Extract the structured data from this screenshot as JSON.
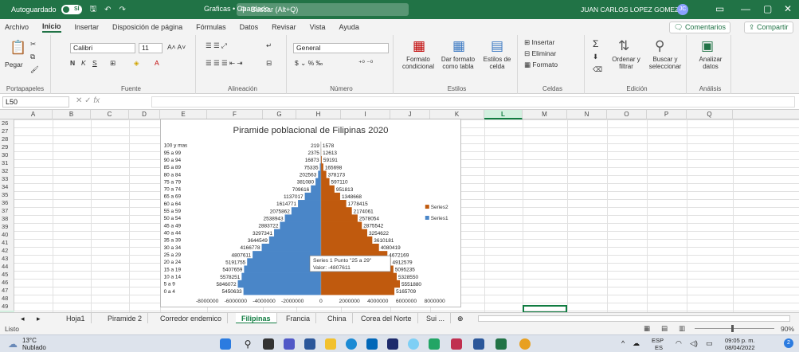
{
  "titlebar": {
    "autosave": "Autoguardado",
    "autosave_state": "SÍ",
    "doc_title": "Graficas • Guardado",
    "search": "Buscar (Alt+Q)",
    "user": "JUAN CARLOS LOPEZ GOMEZ",
    "initials": "JC"
  },
  "menu": [
    "Archivo",
    "Inicio",
    "Insertar",
    "Disposición de página",
    "Fórmulas",
    "Datos",
    "Revisar",
    "Vista",
    "Ayuda"
  ],
  "comments_label": "Comentarios",
  "share_label": "Compartir",
  "ribbon": {
    "clipboard": {
      "paste": "Pegar",
      "label": "Portapapeles"
    },
    "font": {
      "name": "Calibri",
      "size": "11",
      "label": "Fuente"
    },
    "alignment": {
      "label": "Alineación"
    },
    "number": {
      "format": "General",
      "label": "Número"
    },
    "styles": {
      "cond": "Formato condicional",
      "table": "Dar formato como tabla",
      "cell": "Estilos de celda",
      "label": "Estilos"
    },
    "cells": {
      "insert": "Insertar",
      "delete": "Eliminar",
      "format": "Formato",
      "label": "Celdas"
    },
    "editing": {
      "sort": "Ordenar y filtrar",
      "find": "Buscar y seleccionar",
      "label": "Edición"
    },
    "analysis": {
      "analyze": "Analizar datos",
      "label": "Análisis"
    }
  },
  "namebox": "L50",
  "fx": "fx",
  "columns": [
    "A",
    "B",
    "C",
    "D",
    "E",
    "F",
    "G",
    "H",
    "I",
    "J",
    "K",
    "L",
    "M",
    "N",
    "O",
    "P",
    "Q"
  ],
  "rows": [
    "26",
    "27",
    "28",
    "29",
    "30",
    "31",
    "32",
    "33",
    "34",
    "35",
    "36",
    "37",
    "38",
    "39",
    "40",
    "41",
    "42",
    "43",
    "44",
    "45",
    "46",
    "47",
    "48",
    "49",
    "50"
  ],
  "sheets": [
    "Hoja1",
    "Piramide 2",
    "Corredor endemico",
    "Filipinas",
    "Francia",
    "China",
    "Corea del Norte",
    "Sui ..."
  ],
  "active_sheet": "Filipinas",
  "status": {
    "ready": "Listo",
    "zoom": "90%"
  },
  "taskbar": {
    "temp": "13°C",
    "weather": "Nublado",
    "lang": "ESP",
    "region": "ES",
    "time": "09:05 p. m.",
    "date": "08/04/2022"
  },
  "colors": {
    "excel_green": "#217346",
    "series1": "#4a86c8",
    "series2": "#c05a0e"
  },
  "chart_data": {
    "type": "bar",
    "orientation": "horizontal",
    "title": "Piramide poblacional de Filipinas 2020",
    "categories": [
      "0 a 4",
      "5 a 9",
      "10 a 14",
      "15 a 19",
      "20 a 24",
      "25 a 29",
      "30 a 34",
      "35 a 39",
      "40 a 44",
      "45 a 49",
      "50 a 54",
      "55 a 59",
      "60 a 64",
      "65 a 69",
      "70 a 74",
      "75 a 79",
      "80 a 84",
      "85 a 89",
      "90 a 94",
      "95 a 99",
      "100 y mas"
    ],
    "series": [
      {
        "name": "Series1",
        "color": "#4a86c8",
        "values": [
          -5450633,
          -5846072,
          -5578251,
          -5407659,
          -5191755,
          -4807611,
          -4166778,
          -3644549,
          -3297341,
          -2883722,
          -2538943,
          -2075862,
          -1614771,
          -1137017,
          -709616,
          -381080,
          -202563,
          -75335,
          -16873,
          -2375,
          -219
        ]
      },
      {
        "name": "Series2",
        "color": "#c05a0e",
        "values": [
          5165709,
          5551880,
          5328550,
          5095235,
          4912579,
          4672169,
          4080419,
          3610181,
          3254622,
          2875542,
          2578054,
          2174061,
          1778415,
          1348668,
          951813,
          597110,
          378173,
          165698,
          59191,
          12613,
          1578
        ]
      }
    ],
    "labels_series1": [
      "5450633",
      "5846072",
      "5578251",
      "5407659",
      "5191755",
      "4807611",
      "4166778",
      "3644549",
      "3297341",
      "2883722",
      "2538943",
      "2075862",
      "1614771",
      "1137017",
      "709616",
      "381080",
      "202563",
      "75335",
      "16873",
      "2375",
      "219"
    ],
    "labels_series2": [
      "5165709",
      "5551880",
      "5328550",
      "5095235",
      "4912579",
      "4672169",
      "4080419",
      "3610181",
      "3254622",
      "2875542",
      "2578054",
      "2174061",
      "1778415",
      "1348668",
      "951813",
      "597110",
      "378173",
      "165698",
      "59191",
      "12613",
      "1578"
    ],
    "xticks": [
      "-8000000",
      "-6000000",
      "-4000000",
      "-2000000",
      "0",
      "2000000",
      "4000000",
      "6000000",
      "8000000"
    ],
    "xlim": [
      -8000000,
      8000000
    ],
    "legend": [
      "Series2",
      "Series1"
    ],
    "legend_position": "right",
    "tooltip": {
      "line1": "Series 1 Punto \"25 a 29\"",
      "line2": "Valor: -4807611"
    }
  }
}
